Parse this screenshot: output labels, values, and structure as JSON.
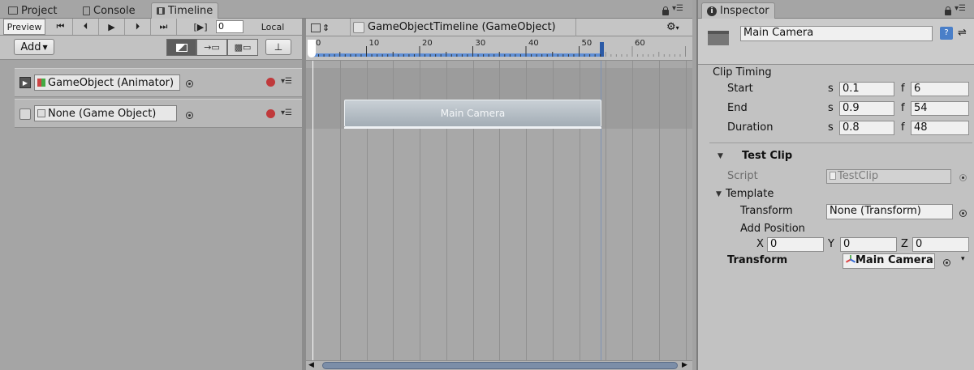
{
  "tabs": {
    "project": "Project",
    "console": "Console",
    "timeline": "Timeline",
    "inspector": "Inspector"
  },
  "timeline_toolbar": {
    "preview": "Preview",
    "frame_value": "0",
    "local": "Local",
    "add": "Add"
  },
  "tracks": [
    {
      "binding": "GameObject (Animator)"
    },
    {
      "binding": "None (Game Object)"
    }
  ],
  "timeline_header": {
    "breadcrumb": "GameObjectTimeline (GameObject)"
  },
  "ruler": {
    "labels": [
      "0",
      "10",
      "20",
      "30",
      "40",
      "50",
      "60"
    ]
  },
  "clip": {
    "label": "Main Camera"
  },
  "inspector": {
    "object_name": "Main Camera",
    "clip_timing": {
      "title": "Clip Timing",
      "start_label": "Start",
      "end_label": "End",
      "duration_label": "Duration",
      "s_label": "s",
      "f_label": "f",
      "start_s": "0.1",
      "start_f": "6",
      "end_s": "0.9",
      "end_f": "54",
      "duration_s": "0.8",
      "duration_f": "48"
    },
    "test_clip": {
      "title": "Test Clip",
      "script_label": "Script",
      "script_value": "TestClip",
      "template_label": "Template",
      "transform_label": "Transform",
      "transform_value": "None (Transform)",
      "add_position_label": "Add Position",
      "x_label": "X",
      "y_label": "Y",
      "z_label": "Z",
      "x": "0",
      "y": "0",
      "z": "0",
      "transform_bold_label": "Transform",
      "transform_bold_value": "Main Camera"
    }
  }
}
